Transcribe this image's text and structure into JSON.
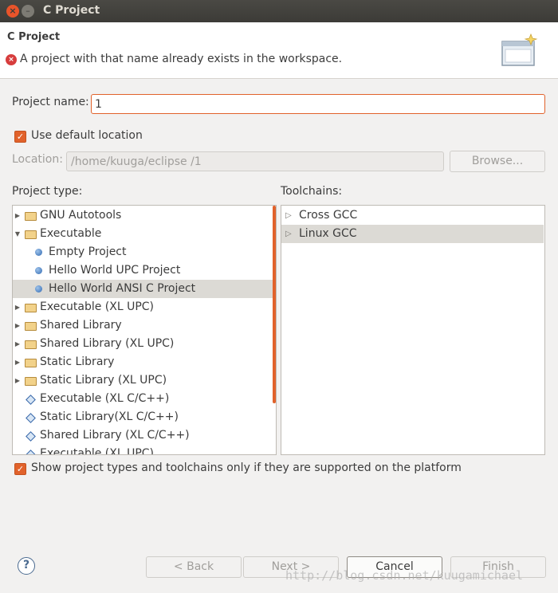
{
  "window": {
    "title": "C Project"
  },
  "banner": {
    "title": "C Project",
    "error_message": "A project with that name already exists in the workspace."
  },
  "project_name": {
    "label": "Project name:",
    "value": "1"
  },
  "default_location": {
    "label": "Use default location",
    "checked": true
  },
  "location": {
    "label": "Location:",
    "value": "/home/kuuga/eclipse /1",
    "browse_label": "Browse..."
  },
  "project_type": {
    "label": "Project type:",
    "items": [
      {
        "label": "GNU Autotools",
        "icon": "folder-icon",
        "arrow": "collapsed"
      },
      {
        "label": "Executable",
        "icon": "folder-icon",
        "arrow": "expanded"
      },
      {
        "label": "Empty Project",
        "icon": "blue-dot-icon"
      },
      {
        "label": "Hello World UPC Project",
        "icon": "blue-dot-icon"
      },
      {
        "label": "Hello World ANSI C Project",
        "icon": "blue-dot-icon",
        "selected": true
      },
      {
        "label": "Executable (XL UPC)",
        "icon": "folder-icon",
        "arrow": "collapsed"
      },
      {
        "label": "Shared Library",
        "icon": "folder-icon",
        "arrow": "collapsed"
      },
      {
        "label": "Shared Library (XL UPC)",
        "icon": "folder-icon",
        "arrow": "collapsed"
      },
      {
        "label": "Static Library",
        "icon": "folder-icon",
        "arrow": "collapsed"
      },
      {
        "label": "Static Library (XL UPC)",
        "icon": "folder-icon",
        "arrow": "collapsed"
      },
      {
        "label": "Executable (XL C/C++)",
        "icon": "diamond-icon"
      },
      {
        "label": "Static Library(XL C/C++)",
        "icon": "diamond-icon"
      },
      {
        "label": "Shared Library (XL C/C++)",
        "icon": "diamond-icon"
      },
      {
        "label": "Executable (XL UPC)",
        "icon": "diamond-icon"
      }
    ]
  },
  "toolchains": {
    "label": "Toolchains:",
    "items": [
      {
        "label": "Cross GCC"
      },
      {
        "label": "Linux GCC",
        "selected": true
      }
    ]
  },
  "filter": {
    "label": "Show project types and toolchains only if they are supported on the platform",
    "checked": true
  },
  "buttons": {
    "back": "< Back",
    "next": "Next >",
    "cancel": "Cancel",
    "finish": "Finish"
  },
  "watermark": "http://blog.csdn.net/kuugamichael",
  "colors": {
    "accent": "#e1622b",
    "error": "#d73d3d",
    "selection": "#dcdad5"
  }
}
